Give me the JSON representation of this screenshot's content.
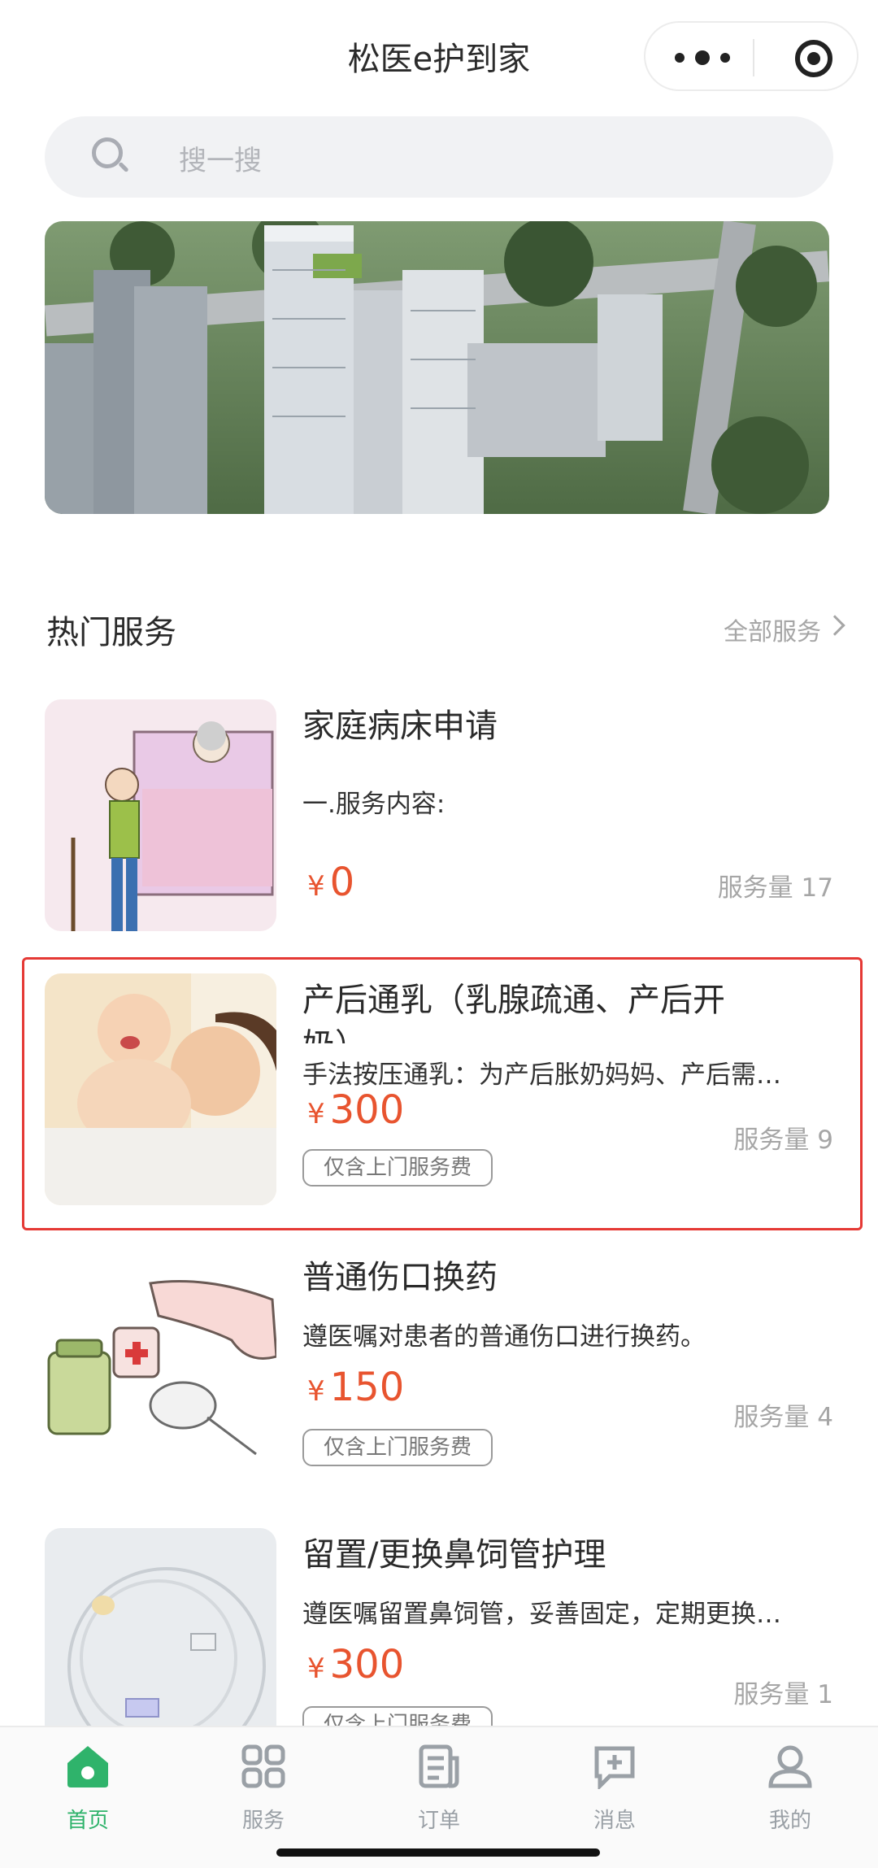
{
  "header": {
    "title": "松医e护到家"
  },
  "search": {
    "placeholder": "搜一搜"
  },
  "section": {
    "title": "热门服务",
    "more_label": "全部服务"
  },
  "services": [
    {
      "name": "家庭病床申请",
      "desc": "一.服务内容:",
      "price": "0",
      "currency": "¥",
      "volume": "服务量 17",
      "tag": ""
    },
    {
      "name": "产后通乳（乳腺疏通、产后开",
      "name_cont": "奶）",
      "desc": "手法按压通乳：为产后胀奶妈妈、产后需…",
      "price": "300",
      "currency": "¥",
      "volume": "服务量 9",
      "tag": "仅含上门服务费"
    },
    {
      "name": "普通伤口换药",
      "desc": "遵医嘱对患者的普通伤口进行换药。",
      "price": "150",
      "currency": "¥",
      "volume": "服务量 4",
      "tag": "仅含上门服务费"
    },
    {
      "name": "留置/更换鼻饲管护理",
      "desc": "遵医嘱留置鼻饲管，妥善固定，定期更换…",
      "price": "300",
      "currency": "¥",
      "volume": "服务量 1",
      "tag": "仅含上门服务费"
    }
  ],
  "tabbar": {
    "items": [
      {
        "label": "首页",
        "icon": "home-icon",
        "active": true
      },
      {
        "label": "服务",
        "icon": "grid-icon",
        "active": false
      },
      {
        "label": "订单",
        "icon": "document-icon",
        "active": false
      },
      {
        "label": "消息",
        "icon": "message-icon",
        "active": false
      },
      {
        "label": "我的",
        "icon": "user-icon",
        "active": false
      }
    ]
  },
  "colors": {
    "accent": "#2fb36b",
    "price": "#e8542f",
    "highlight": "#e53935"
  }
}
